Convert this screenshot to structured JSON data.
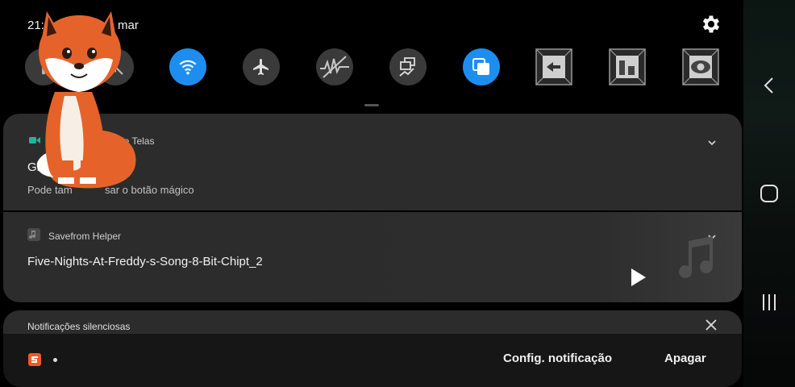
{
  "status": {
    "time": "21:5",
    "date_fragment": "de mar"
  },
  "quick_settings": {
    "tiles": [
      {
        "name": "flashlight-tile",
        "state": "off"
      },
      {
        "name": "sound-tile",
        "state": "off"
      },
      {
        "name": "wifi-tile",
        "state": "on"
      },
      {
        "name": "airplane-mode-tile",
        "state": "off"
      },
      {
        "name": "mobile-data-tile",
        "state": "off"
      },
      {
        "name": "screen-record-tile",
        "state": "off"
      },
      {
        "name": "multi-window-tile",
        "state": "on"
      },
      {
        "name": "back-shortcut-tile",
        "state": "off"
      },
      {
        "name": "split-screen-tile",
        "state": "off"
      },
      {
        "name": "eye-comfort-tile",
        "state": "off"
      }
    ],
    "accent_color": "#1d8ef0"
  },
  "notifications": {
    "recorder": {
      "app_name_start": "A",
      "app_name_end": "de Telas",
      "title": "Gra",
      "subtitle_start": "Pode tam",
      "subtitle_end": "sar o botão mágico"
    },
    "music": {
      "app_name": "Savefrom Helper",
      "title": "Five-Nights-At-Freddy-s-Song-8-Bit-Chipt_2"
    },
    "silent": {
      "header": "Notificações silenciosas"
    }
  },
  "bottom_bar": {
    "settings_label": "Config. notificação",
    "clear_label": "Apagar",
    "badge_color": "#f05a28"
  },
  "icons": {
    "settings": "gear-icon",
    "play": "play-icon",
    "music_note": "music-note-icon",
    "close": "close-icon",
    "chevron": "chevron-down-icon"
  }
}
